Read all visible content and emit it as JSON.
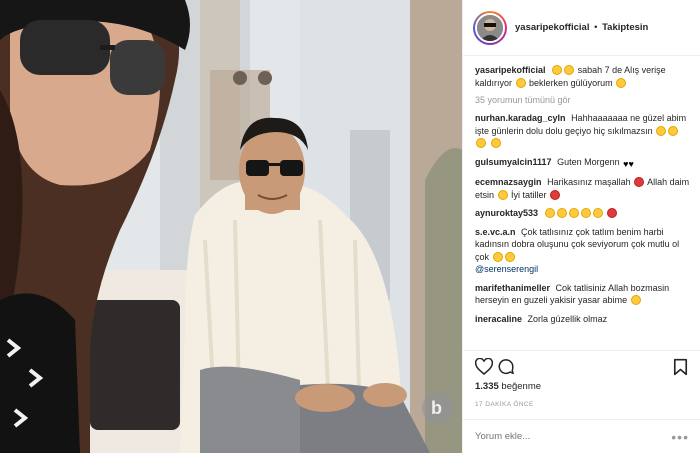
{
  "post": {
    "username": "yasaripekofficial",
    "separator": "•",
    "follow_status": "Takiptesin",
    "caption": {
      "user": "yasaripekofficial",
      "text_a": "sabah 7 de Alış verişe kaldırıyor",
      "text_b": "beklerken gülüyorum"
    },
    "view_all_comments": "35 yorumun tümünü gör",
    "comments": [
      {
        "user": "nurhan.karadag_cyln",
        "text": "Hahhaaaaaaa ne güzel abim işte günlerin dolu dolu geçiyo hiç sıkılmazsın"
      },
      {
        "user": "gulsumyalcin1117",
        "text": "Guten Morgenn"
      },
      {
        "user": "ecemnazsaygin",
        "text": "Harikasınız maşallah",
        "text_b": "Allah daim etsin",
        "text_c": "İyi tatiller"
      },
      {
        "user": "aynuroktay533",
        "text": ""
      },
      {
        "user": "s.e.vc.a.n",
        "text": "Çok tatlısınız çok tatlım benim harbi kadınsın dobra oluşunu çok seviyorum çok mutlu ol çok",
        "mention": "@serenserengil"
      },
      {
        "user": "marifethanimeller",
        "text": "Cok tatlisiniz Allah bozmasin herseyin en guzeli yakisir yasar abime"
      },
      {
        "user": "ineracaline",
        "text": "Zorla güzellik olmaz"
      }
    ],
    "likes_count": "1.335",
    "likes_label": "beğenme",
    "time_ago": "17 DAKİKA ÖNCE",
    "comment_placeholder": "Yorum ekle...",
    "more_options": "•••"
  },
  "icons": {
    "like": "heart-icon",
    "comment": "comment-bubble-icon",
    "save": "bookmark-icon",
    "more": "ellipsis-icon"
  }
}
